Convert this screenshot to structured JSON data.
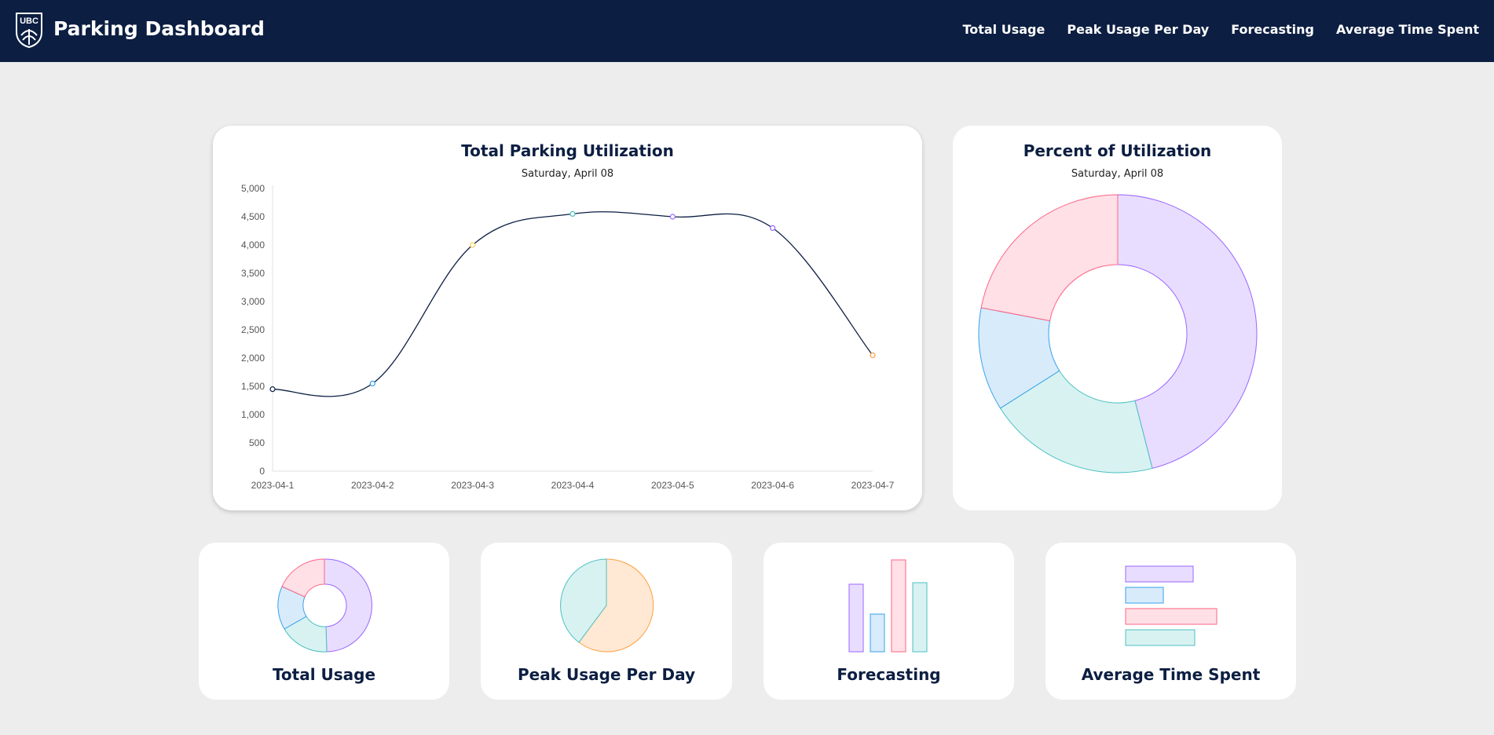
{
  "header": {
    "logo_text": "UBC",
    "brand": "Parking Dashboard",
    "nav": [
      "Total Usage",
      "Peak Usage Per Day",
      "Forecasting",
      "Average Time Spent"
    ]
  },
  "main_chart": {
    "title": "Total Parking Utilization",
    "subtitle": "Saturday, April 08"
  },
  "donut_card": {
    "title": "Percent of Utilization",
    "subtitle": "Saturday, April 08"
  },
  "tiles": [
    {
      "label": "Total Usage"
    },
    {
      "label": "Peak Usage Per Day"
    },
    {
      "label": "Forecasting"
    },
    {
      "label": "Average Time Spent"
    }
  ],
  "chart_data": [
    {
      "type": "line",
      "title": "Total Parking Utilization",
      "subtitle": "Saturday, April 08",
      "x": [
        "2023-04-1",
        "2023-04-2",
        "2023-04-3",
        "2023-04-4",
        "2023-04-5",
        "2023-04-6",
        "2023-04-7"
      ],
      "y": [
        1450,
        1550,
        4000,
        4550,
        4500,
        4300,
        2050
      ],
      "yticks": [
        0,
        500,
        1000,
        1500,
        2000,
        2500,
        3000,
        3500,
        4000,
        4500,
        5000
      ],
      "ylim": [
        0,
        5000
      ],
      "line_color": "#0c1e42",
      "point_colors": [
        "#0c1e42",
        "#36a2eb",
        "#ffce56",
        "#4bc0c0",
        "#9966ff",
        "#9966ff",
        "#ff9f40"
      ],
      "grid": false
    },
    {
      "type": "pie",
      "title": "Percent of Utilization",
      "subtitle": "Saturday, April 08",
      "donut": true,
      "values": [
        46,
        20,
        12,
        22
      ],
      "colors": [
        "#9966ff",
        "#4bc0c0",
        "#36a2eb",
        "#ff6384"
      ]
    }
  ],
  "colors": {
    "nav_bg": "#0c1e42",
    "page_bg": "#ededed",
    "purple": "#9966ff",
    "teal": "#4bc0c0",
    "blue": "#36a2eb",
    "pink": "#ff6384",
    "orange": "#ff9f40"
  },
  "icons": [
    "ubc-crest-icon",
    "mini-donut-icon",
    "mini-pie-icon",
    "mini-bar-icon",
    "mini-hbar-icon"
  ]
}
